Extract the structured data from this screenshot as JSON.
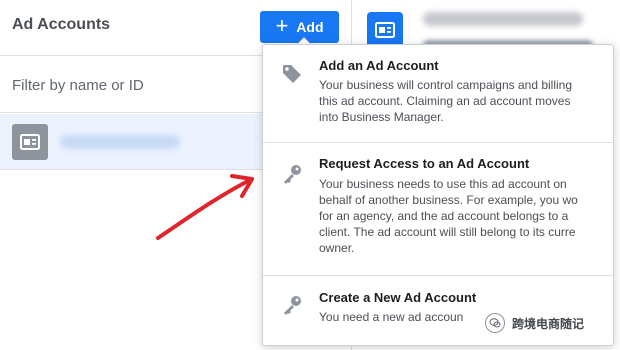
{
  "left_panel": {
    "title": "Ad Accounts",
    "add_button_label": "Add",
    "filter_placeholder": "Filter by name or ID"
  },
  "menu": {
    "items": [
      {
        "title": "Add an Ad Account",
        "lines": [
          "Your business will control campaigns and billing",
          "this ad account. Claiming an ad account moves",
          "into Business Manager."
        ],
        "icon": "tag-icon"
      },
      {
        "title": "Request Access to an Ad Account",
        "lines": [
          "Your business needs to use this ad account on",
          "behalf of another business. For example, you wo",
          "for an agency, and the ad account belongs to a",
          "client. The ad account will still belong to its curre",
          "owner."
        ],
        "icon": "key-icon"
      },
      {
        "title": "Create a New Ad Account",
        "lines": [
          "You need a new ad accoun"
        ],
        "icon": "key-icon"
      }
    ]
  },
  "watermark": {
    "text": "跨境电商随记"
  },
  "colors": {
    "accent": "#1877f2",
    "arrow": "#e0242b",
    "selected_row": "#ecf3ff"
  }
}
